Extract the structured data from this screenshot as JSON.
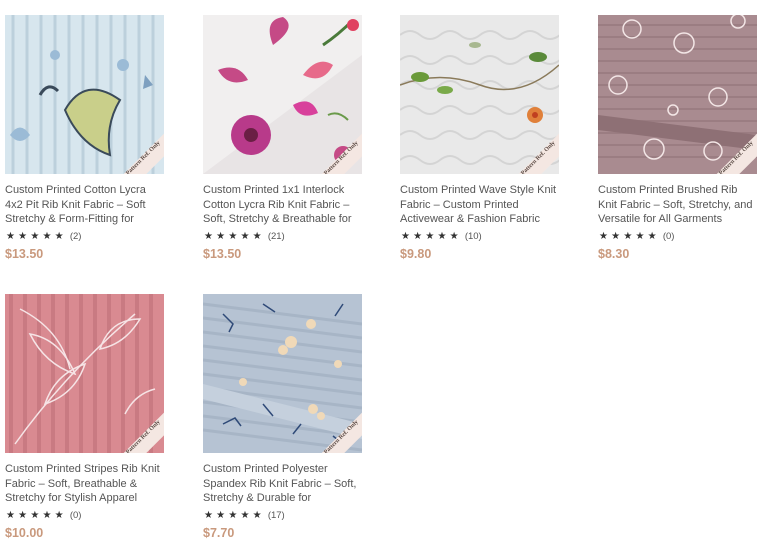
{
  "products": [
    {
      "title": "Custom Printed Cotton Lycra 4x2 Pit Rib Knit Fabric – Soft Stretchy & Form-Fitting for",
      "stars": "★★★★★",
      "reviews": "(2)",
      "price": "$13.50",
      "badge": "Pattern Ref. Only",
      "image": "light-blue-rib-cartoon-print"
    },
    {
      "title": "Custom Printed 1x1 Interlock Cotton Lycra Rib Knit Fabric – Soft, Stretchy & Breathable for",
      "stars": "★★★★★",
      "reviews": "(21)",
      "price": "$13.50",
      "badge": "Pattern Ref. Only",
      "image": "white-floral-magenta-print"
    },
    {
      "title": "Custom Printed Wave Style Knit Fabric – Custom Printed Activewear & Fashion Fabric",
      "stars": "★★★★★",
      "reviews": "(10)",
      "price": "$9.80",
      "badge": "Pattern Ref. Only",
      "image": "white-wave-vine-print"
    },
    {
      "title": "Custom Printed Brushed Rib Knit Fabric – Soft, Stretchy, and Versatile for All Garments",
      "stars": "★★★★★",
      "reviews": "(0)",
      "price": "$8.30",
      "badge": "Pattern Ref. Only",
      "image": "mauve-daisy-print"
    },
    {
      "title": "Custom Printed Stripes Rib Knit Fabric – Soft, Breathable & Stretchy for Stylish Apparel",
      "stars": "★★★★★",
      "reviews": "(0)",
      "price": "$10.00",
      "badge": "Pattern Ref. Only",
      "image": "pink-rib-leaf-line-print"
    },
    {
      "title": "Custom Printed Polyester Spandex Rib Knit Fabric – Soft, Stretchy & Durable for",
      "stars": "★★★★★",
      "reviews": "(17)",
      "price": "$7.70",
      "badge": "Pattern Ref. Only",
      "image": "blue-grey-flower-print"
    }
  ],
  "colors": {
    "price": "#c9997d",
    "title": "#555555",
    "star": "#333333",
    "badge_bg": "#f4e7e2"
  }
}
